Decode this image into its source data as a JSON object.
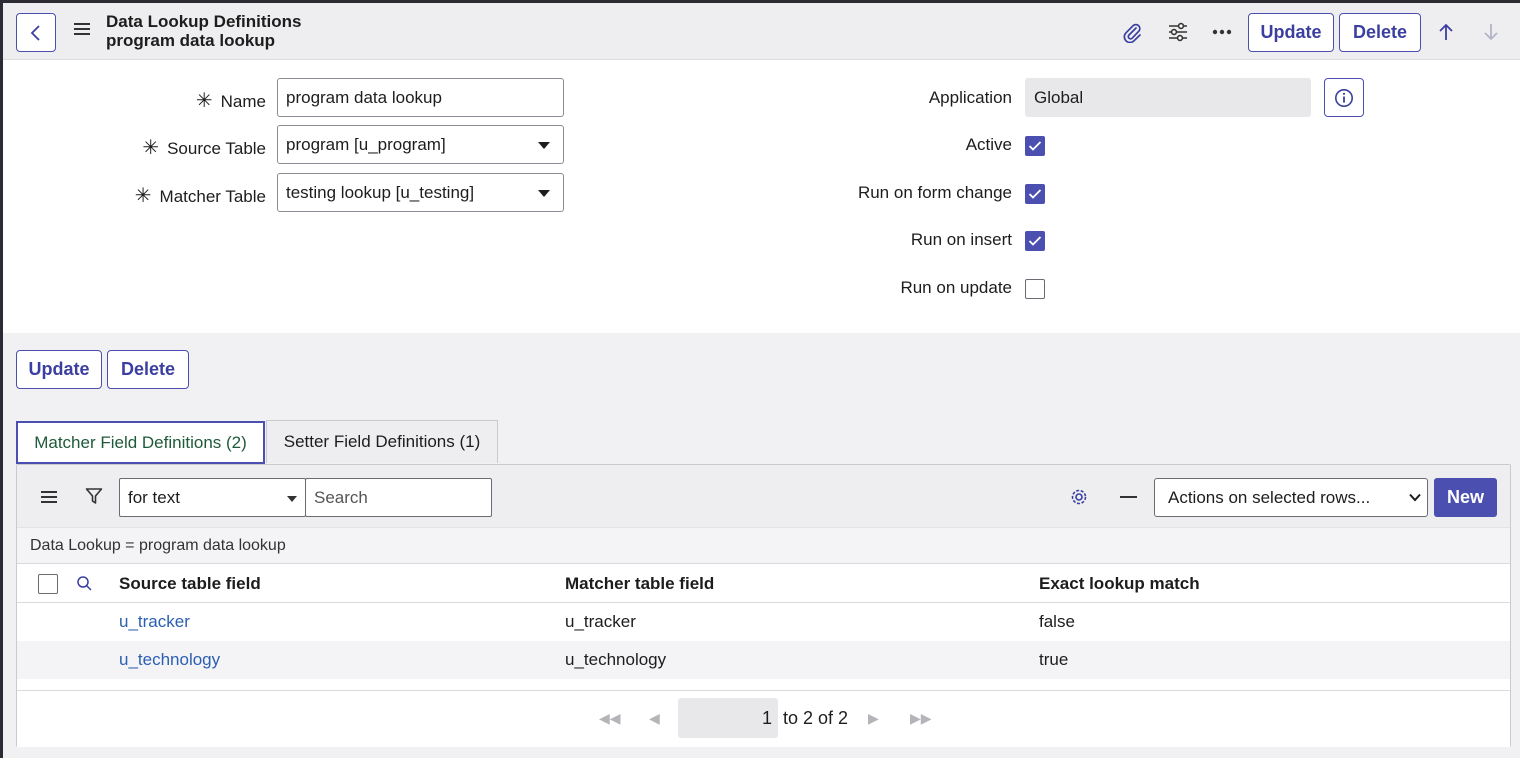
{
  "header": {
    "title": "Data Lookup Definitions",
    "subtitle": "program data lookup",
    "update_label": "Update",
    "delete_label": "Delete"
  },
  "form": {
    "name_label": "Name",
    "name_value": "program data lookup",
    "source_table_label": "Source Table",
    "source_table_value": "program [u_program]",
    "matcher_table_label": "Matcher Table",
    "matcher_table_value": "testing lookup [u_testing]",
    "application_label": "Application",
    "application_value": "Global",
    "active_label": "Active",
    "active_checked": true,
    "run_on_form_change_label": "Run on form change",
    "run_on_form_change_checked": true,
    "run_on_insert_label": "Run on insert",
    "run_on_insert_checked": true,
    "run_on_update_label": "Run on update",
    "run_on_update_checked": false
  },
  "form_buttons": {
    "update_label": "Update",
    "delete_label": "Delete"
  },
  "tabs": [
    {
      "label": "Matcher Field Definitions (2)",
      "active": true
    },
    {
      "label": "Setter Field Definitions (1)",
      "active": false
    }
  ],
  "list": {
    "field_select_value": "for text",
    "search_placeholder": "Search",
    "actions_select_value": "Actions on selected rows...",
    "new_label": "New",
    "breadcrumb": "Data Lookup = program data lookup",
    "columns": [
      "Source table field",
      "Matcher table field",
      "Exact lookup match"
    ],
    "rows": [
      {
        "source": "u_tracker",
        "matcher": "u_tracker",
        "exact": "false"
      },
      {
        "source": "u_technology",
        "matcher": "u_technology",
        "exact": "true"
      }
    ],
    "pager": {
      "page_value": "1",
      "range_text": "to 2 of 2"
    }
  },
  "colors": {
    "accent": "#4b4fb0",
    "link": "#2b5fb3",
    "active_tab_text": "#1f5a3a"
  }
}
